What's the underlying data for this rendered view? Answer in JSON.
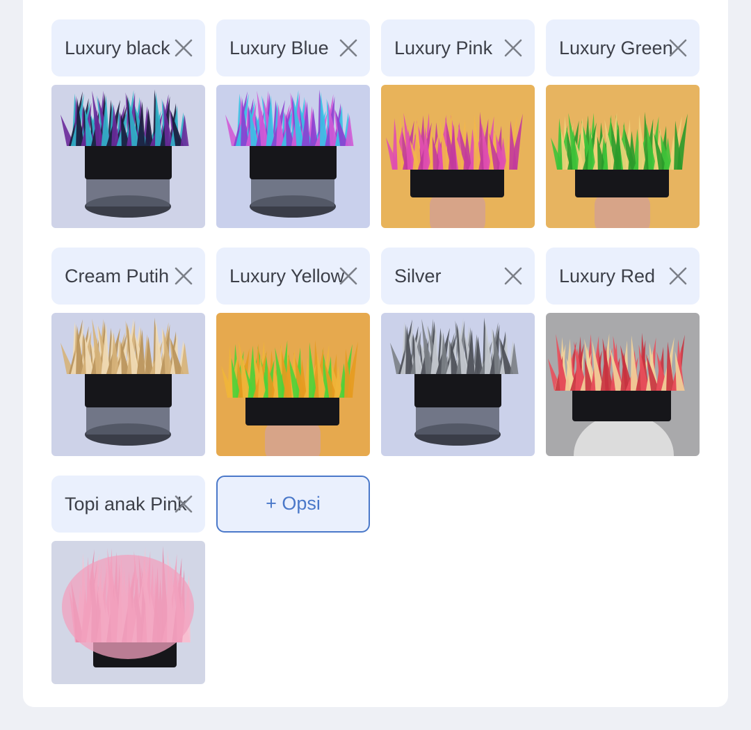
{
  "variants": [
    {
      "label": "Luxury black",
      "bg": "#cfd3e8",
      "hair": [
        "#6a2a9a",
        "#2fb3c9",
        "#1a1a3a"
      ],
      "holder": "stand"
    },
    {
      "label": "Luxury Blue",
      "bg": "#c9d0ec",
      "hair": [
        "#d25ad6",
        "#35c3e6",
        "#8b3fd0"
      ],
      "holder": "stand"
    },
    {
      "label": "Luxury Pink",
      "bg": "#e8b35a",
      "hair": [
        "#e04fb0",
        "#f3b64a",
        "#c23a9c"
      ],
      "holder": "hand"
    },
    {
      "label": "Luxury Green",
      "bg": "#e7b460",
      "hair": [
        "#3fc33a",
        "#f0d27a",
        "#2a9a2a"
      ],
      "holder": "hand"
    },
    {
      "label": "Cream Putih",
      "bg": "#cdd2e8",
      "hair": [
        "#d6b27a",
        "#f1dcb6",
        "#b8925a"
      ],
      "holder": "stand"
    },
    {
      "label": "Luxury Yellow",
      "bg": "#e6a94e",
      "hair": [
        "#f0b53a",
        "#4ed13a",
        "#e59b20"
      ],
      "holder": "hand"
    },
    {
      "label": "Silver",
      "bg": "#cbd1ea",
      "hair": [
        "#7b7f86",
        "#c6cbd2",
        "#4a4e55"
      ],
      "holder": "stand"
    },
    {
      "label": "Luxury Red",
      "bg": "#a9a9ab",
      "hair": [
        "#e8505c",
        "#f2d39a",
        "#c8323f"
      ],
      "holder": "head"
    },
    {
      "label": "Topi anak Pink",
      "bg": "#d2d6e6",
      "hair": [
        "#f2a0bd",
        "#f7c2d3",
        "#e58aab"
      ],
      "holder": "kid"
    }
  ],
  "add_option_label": "+ Opsi"
}
